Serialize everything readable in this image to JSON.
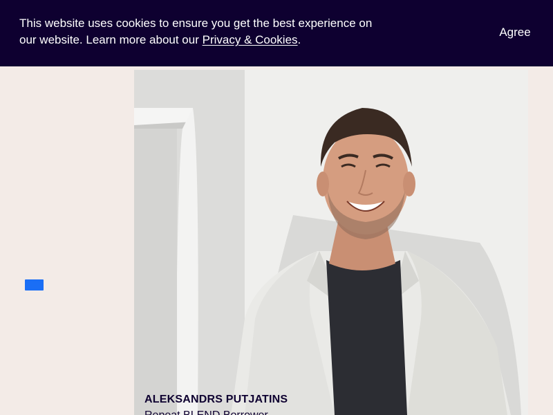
{
  "cookie_banner": {
    "text_before_link": "This website uses cookies to ensure you get the best experience on our website. Learn more about our ",
    "link_text": "Privacy & Cookies",
    "text_after_link": ".",
    "agree_label": "Agree",
    "background_color": "#0e0030"
  },
  "accent_color": "#1a6ef5",
  "page_background": "#f3ebe7",
  "profile": {
    "name": "ALEKSANDRS PUTJATINS",
    "role": "Repeat BLEND Borrower"
  }
}
